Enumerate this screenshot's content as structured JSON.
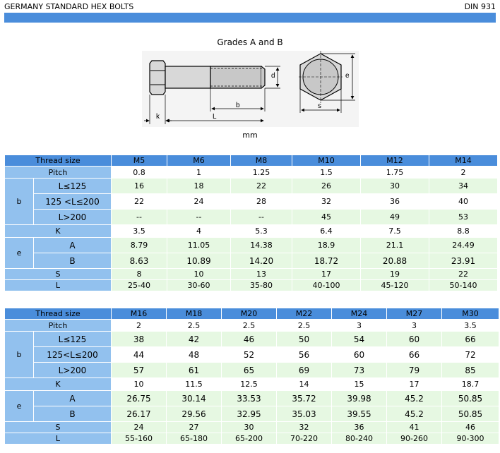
{
  "header": {
    "title": "GERMANY STANDARD HEX BOLTS",
    "standard": "DIN 931"
  },
  "figure": {
    "title": "Grades A and B",
    "units": "mm",
    "labels": [
      "d",
      "k",
      "b",
      "L",
      "e",
      "s"
    ]
  },
  "table1": {
    "thread_label": "Thread size",
    "sizes": [
      "M5",
      "M6",
      "M8",
      "M10",
      "M12",
      "M14"
    ],
    "pitch": [
      "0.8",
      "1",
      "1.25",
      "1.5",
      "1.75",
      "2"
    ],
    "b_label": "b",
    "b_rows": [
      {
        "label": "L≤125",
        "values": [
          "16",
          "18",
          "22",
          "26",
          "30",
          "34"
        ]
      },
      {
        "label": "125 <L≤200",
        "values": [
          "22",
          "24",
          "28",
          "32",
          "36",
          "40"
        ]
      },
      {
        "label": "L>200",
        "values": [
          "--",
          "--",
          "--",
          "45",
          "49",
          "53"
        ]
      }
    ],
    "k_label": "K",
    "k": [
      "3.5",
      "4",
      "5.3",
      "6.4",
      "7.5",
      "8.8"
    ],
    "e_label": "e",
    "e_rows": [
      {
        "label": "A",
        "values": [
          "8.79",
          "11.05",
          "14.38",
          "18.9",
          "21.1",
          "24.49"
        ]
      },
      {
        "label": "B",
        "values": [
          "8.63",
          "10.89",
          "14.20",
          "18.72",
          "20.88",
          "23.91"
        ]
      }
    ],
    "s_label": "S",
    "s": [
      "8",
      "10",
      "13",
      "17",
      "19",
      "22"
    ],
    "l_label": "L",
    "l": [
      "25-40",
      "30-60",
      "35-80",
      "40-100",
      "45-120",
      "50-140"
    ]
  },
  "table2": {
    "thread_label": "Thread size",
    "sizes": [
      "M16",
      "M18",
      "M20",
      "M22",
      "M24",
      "M27",
      "M30"
    ],
    "pitch": [
      "2",
      "2.5",
      "2.5",
      "2.5",
      "3",
      "3",
      "3.5"
    ],
    "b_label": "b",
    "b_rows": [
      {
        "label": "L≤125",
        "values": [
          "38",
          "42",
          "46",
          "50",
          "54",
          "60",
          "66"
        ]
      },
      {
        "label": "125<L≤200",
        "values": [
          "44",
          "48",
          "52",
          "56",
          "60",
          "66",
          "72"
        ]
      },
      {
        "label": "L>200",
        "values": [
          "57",
          "61",
          "65",
          "69",
          "73",
          "79",
          "85"
        ]
      }
    ],
    "k_label": "K",
    "k": [
      "10",
      "11.5",
      "12.5",
      "14",
      "15",
      "17",
      "18.7"
    ],
    "e_label": "e",
    "e_rows": [
      {
        "label": "A",
        "values": [
          "26.75",
          "30.14",
          "33.53",
          "35.72",
          "39.98",
          "45.2",
          "50.85"
        ]
      },
      {
        "label": "B",
        "values": [
          "26.17",
          "29.56",
          "32.95",
          "35.03",
          "39.55",
          "45.2",
          "50.85"
        ]
      }
    ],
    "s_label": "S",
    "s": [
      "24",
      "27",
      "30",
      "32",
      "36",
      "41",
      "46"
    ],
    "l_label": "L",
    "l": [
      "55-160",
      "65-180",
      "65-200",
      "70-220",
      "80-240",
      "90-260",
      "90-300"
    ]
  }
}
